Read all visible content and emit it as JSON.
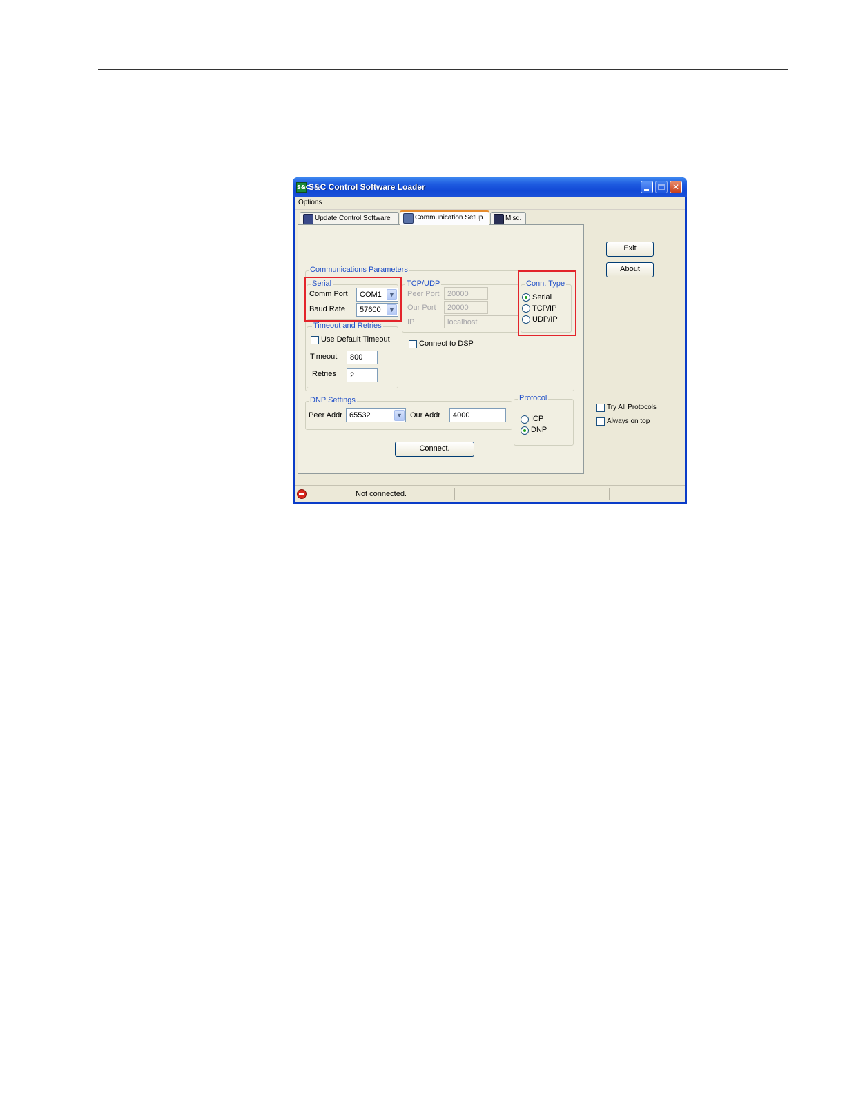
{
  "window": {
    "title": "S&C Control Software Loader",
    "app_icon_text": "S&C"
  },
  "menu": {
    "options": "Options"
  },
  "tabs": [
    {
      "label": "Update Control Software",
      "icon": "monitor-icon",
      "active": false
    },
    {
      "label": "Communication Setup",
      "icon": "connection-icon",
      "active": true
    },
    {
      "label": "Misc.",
      "icon": "misc-icon",
      "active": false
    }
  ],
  "comm": {
    "group_label": "Communications Parameters",
    "serial": {
      "label": "Serial",
      "comm_port_label": "Comm Port",
      "comm_port_value": "COM1",
      "baud_rate_label": "Baud Rate",
      "baud_rate_value": "57600"
    },
    "tcpudp": {
      "label": "TCP/UDP",
      "peer_port_label": "Peer Port",
      "peer_port_value": "20000",
      "our_port_label": "Our Port",
      "our_port_value": "20000",
      "ip_label": "IP",
      "ip_value": "localhost"
    },
    "conn_type": {
      "label": "Conn. Type",
      "options": [
        "Serial",
        "TCP/IP",
        "UDP/IP"
      ],
      "selected": "Serial"
    },
    "timeout": {
      "label": "Timeout and Retries",
      "use_default_label": "Use Default Timeout",
      "use_default_checked": false,
      "timeout_label": "Timeout",
      "timeout_value": "800",
      "retries_label": "Retries",
      "retries_value": "2"
    },
    "connect_dsp_label": "Connect to DSP",
    "connect_dsp_checked": false
  },
  "dnp": {
    "label": "DNP Settings",
    "peer_addr_label": "Peer Addr",
    "peer_addr_value": "65532",
    "our_addr_label": "Our Addr",
    "our_addr_value": "4000"
  },
  "protocol": {
    "label": "Protocol",
    "options": [
      "ICP",
      "DNP"
    ],
    "selected": "DNP"
  },
  "connect_button": "Connect.",
  "side": {
    "exit_button": "Exit",
    "about_button": "About",
    "try_all_label": "Try All Protocols",
    "try_all_checked": false,
    "always_on_top_label": "Always on top",
    "always_on_top_checked": false
  },
  "status": {
    "text": "Not connected."
  },
  "highlight_color": "#e3242b"
}
